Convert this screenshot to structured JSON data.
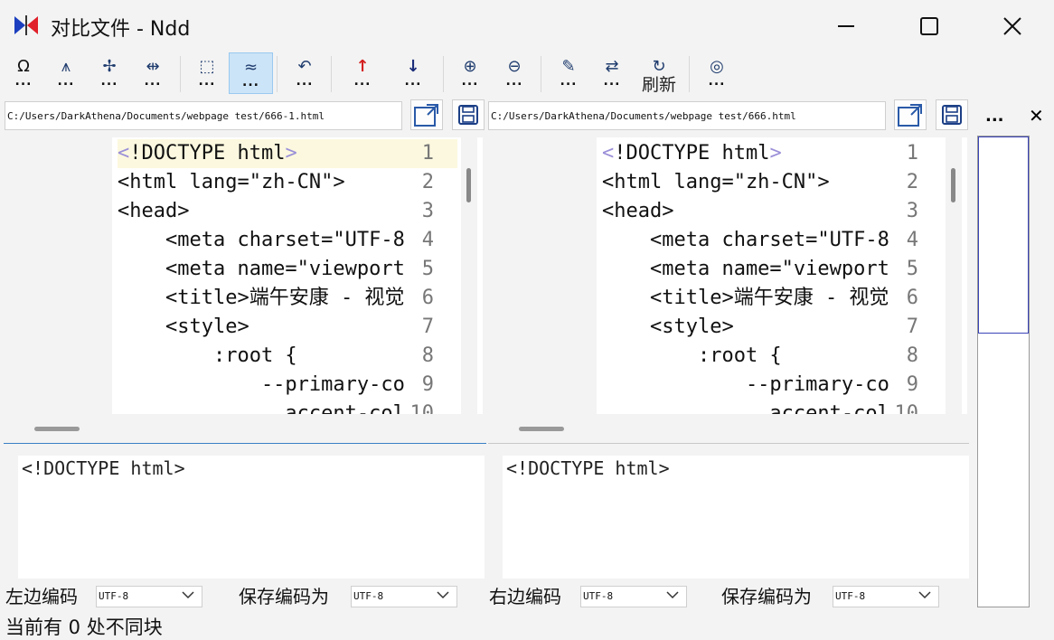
{
  "window": {
    "title": "对比文件 - Ndd"
  },
  "toolbar": {
    "buttons": [
      {
        "name": "special-chars",
        "glyph": "Ω"
      },
      {
        "name": "compare-mode-a",
        "glyph": "⩚"
      },
      {
        "name": "ignore-mode",
        "glyph": "✢"
      },
      {
        "name": "sync-scroll",
        "glyph": "⇹"
      },
      {
        "name": "pick",
        "glyph": "⬚"
      },
      {
        "name": "approx-compare",
        "glyph": "≈"
      },
      {
        "name": "undo",
        "glyph": "↶"
      },
      {
        "name": "prev-diff",
        "glyph": "↑"
      },
      {
        "name": "next-diff",
        "glyph": "↓"
      },
      {
        "name": "zoom-in",
        "glyph": "⊕"
      },
      {
        "name": "zoom-out",
        "glyph": "⊖"
      },
      {
        "name": "clear",
        "glyph": "✎"
      },
      {
        "name": "swap",
        "glyph": "⇄"
      },
      {
        "name": "refresh",
        "glyph": "↻"
      },
      {
        "name": "watch",
        "glyph": "◎"
      }
    ],
    "dots": "...",
    "refresh_label": "刷新"
  },
  "left": {
    "path": "C:/Users/DarkAthena/Documents/webpage test/666-1.html",
    "encoding_label": "左边编码",
    "encoding": "UTF-8",
    "save_label": "保存编码为",
    "save_encoding": "UTF-8",
    "preview": "<!DOCTYPE html>"
  },
  "right": {
    "path": "C:/Users/DarkAthena/Documents/webpage test/666.html",
    "encoding_label": "右边编码",
    "encoding": "UTF-8",
    "save_label": "保存编码为",
    "save_encoding": "UTF-8",
    "preview": "<!DOCTYPE html>"
  },
  "code": {
    "line_numbers": [
      "1",
      "2",
      "3",
      "4",
      "5",
      "6",
      "7",
      "8",
      "9",
      "10"
    ],
    "lines": [
      "<!DOCTYPE html>",
      "<html lang=\"zh-CN\">",
      "<head>",
      "    <meta charset=\"UTF-8",
      "    <meta name=\"viewport",
      "    <title>端午安康 - 视觉",
      "    <style>",
      "        :root {",
      "            --primary-co",
      "              accent-col"
    ]
  },
  "side": {
    "more": "...",
    "close": "✕"
  },
  "status": "当前有 0 处不同块",
  "colors": {
    "accent": "#3a7fc4",
    "highlight": "#fbf8df",
    "active_button": "#cce4f7",
    "red_arrow": "#d42020",
    "blue_arrow": "#1c2e7a"
  }
}
